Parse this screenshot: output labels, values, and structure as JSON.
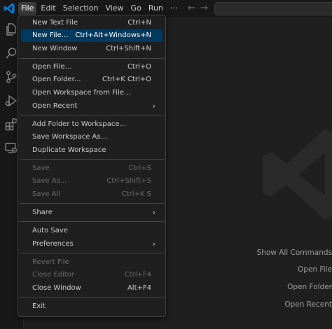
{
  "colors": {
    "accent": "#0078d4",
    "menu_highlight": "#04395e",
    "background": "#1f1f1f",
    "menu_border": "#454545"
  },
  "menubar": {
    "items": [
      "File",
      "Edit",
      "Selection",
      "View",
      "Go",
      "Run",
      "···"
    ]
  },
  "nav": {
    "back_icon": "←",
    "forward_icon": "→"
  },
  "file_menu": {
    "items": [
      {
        "label": "New Text File",
        "shortcut": "Ctrl+N"
      },
      {
        "label": "New File...",
        "shortcut": "Ctrl+Alt+Windows+N"
      },
      {
        "label": "New Window",
        "shortcut": "Ctrl+Shift+N"
      },
      {
        "label": "Open File...",
        "shortcut": "Ctrl+O"
      },
      {
        "label": "Open Folder...",
        "shortcut": "Ctrl+K Ctrl+O"
      },
      {
        "label": "Open Workspace from File...",
        "shortcut": ""
      },
      {
        "label": "Open Recent",
        "shortcut": ""
      },
      {
        "label": "Add Folder to Workspace...",
        "shortcut": ""
      },
      {
        "label": "Save Workspace As...",
        "shortcut": ""
      },
      {
        "label": "Duplicate Workspace",
        "shortcut": ""
      },
      {
        "label": "Save",
        "shortcut": "Ctrl+S"
      },
      {
        "label": "Save As...",
        "shortcut": "Ctrl+Shift+S"
      },
      {
        "label": "Save All",
        "shortcut": "Ctrl+K S"
      },
      {
        "label": "Share",
        "shortcut": ""
      },
      {
        "label": "Auto Save",
        "shortcut": ""
      },
      {
        "label": "Preferences",
        "shortcut": ""
      },
      {
        "label": "Revert File",
        "shortcut": ""
      },
      {
        "label": "Close Editor",
        "shortcut": "Ctrl+F4"
      },
      {
        "label": "Close Window",
        "shortcut": "Alt+F4"
      },
      {
        "label": "Exit",
        "shortcut": ""
      }
    ],
    "submenu_indicator": "›"
  },
  "welcome": {
    "show_all_commands": "Show All Commands",
    "open_file": "Open File",
    "open_folder": "Open Folder",
    "open_recent": "Open Recent"
  }
}
